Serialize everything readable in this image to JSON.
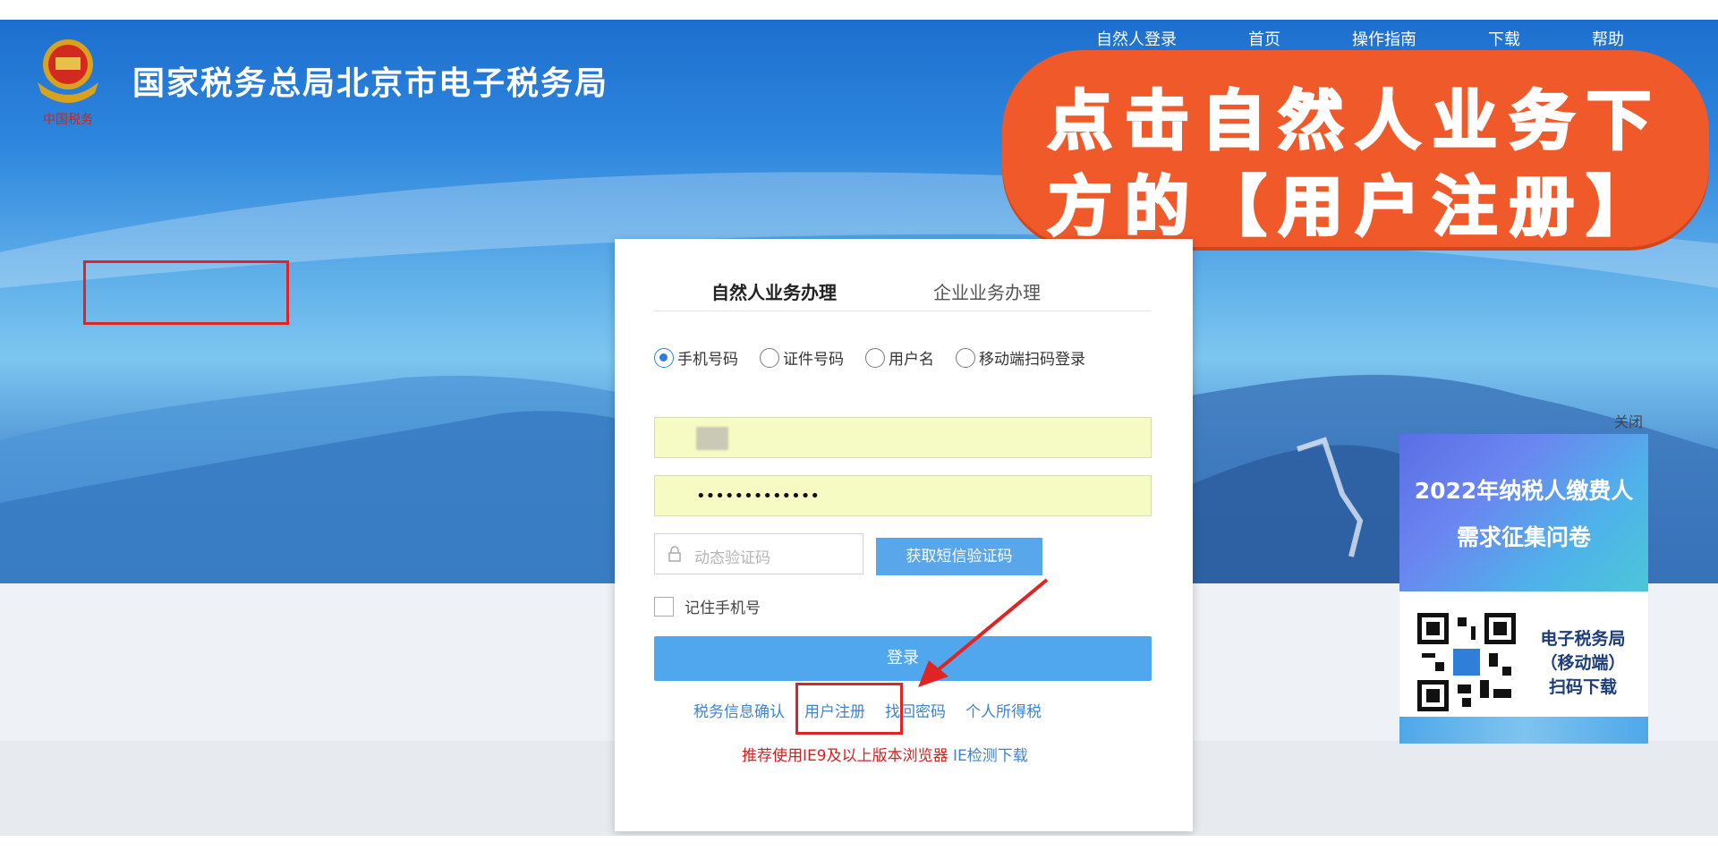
{
  "header": {
    "site_title": "国家税务总局北京市电子税务局",
    "emblem_caption": "中国税务",
    "top_links": [
      "自然人登录",
      "首页",
      "操作指南",
      "下载",
      "帮助"
    ]
  },
  "callout": {
    "line1": "点击自然人业务下",
    "line2": "方的【用户注册】",
    "color": "#f05a2a"
  },
  "login": {
    "tabs": [
      {
        "label": "自然人业务办理",
        "active": true
      },
      {
        "label": "企业业务办理",
        "active": false
      }
    ],
    "login_methods": [
      "手机号码",
      "证件号码",
      "用户名",
      "移动端扫码登录"
    ],
    "selected_method": "手机号码",
    "password_value": "•••••••••••••",
    "code_placeholder": "动态验证码",
    "sms_button": "获取短信验证码",
    "remember_label": "记住手机号",
    "login_button": "登录",
    "links": [
      "税务信息确认",
      "用户注册",
      "找回密码",
      "个人所得税"
    ],
    "browser_tip": "推荐使用IE9及以上版本浏览器",
    "ie_check": "IE检测下载"
  },
  "ad": {
    "close_label": "关闭",
    "title_line1": "2022年纳税人缴费人",
    "title_line2": "需求征集问卷",
    "download_line1": "电子税务局",
    "download_line2": "（移动端）",
    "download_line3": "扫码下载"
  },
  "colors": {
    "accent_blue": "#51a7ee",
    "link_blue": "#3e83cf",
    "highlight_red": "#e02424"
  }
}
